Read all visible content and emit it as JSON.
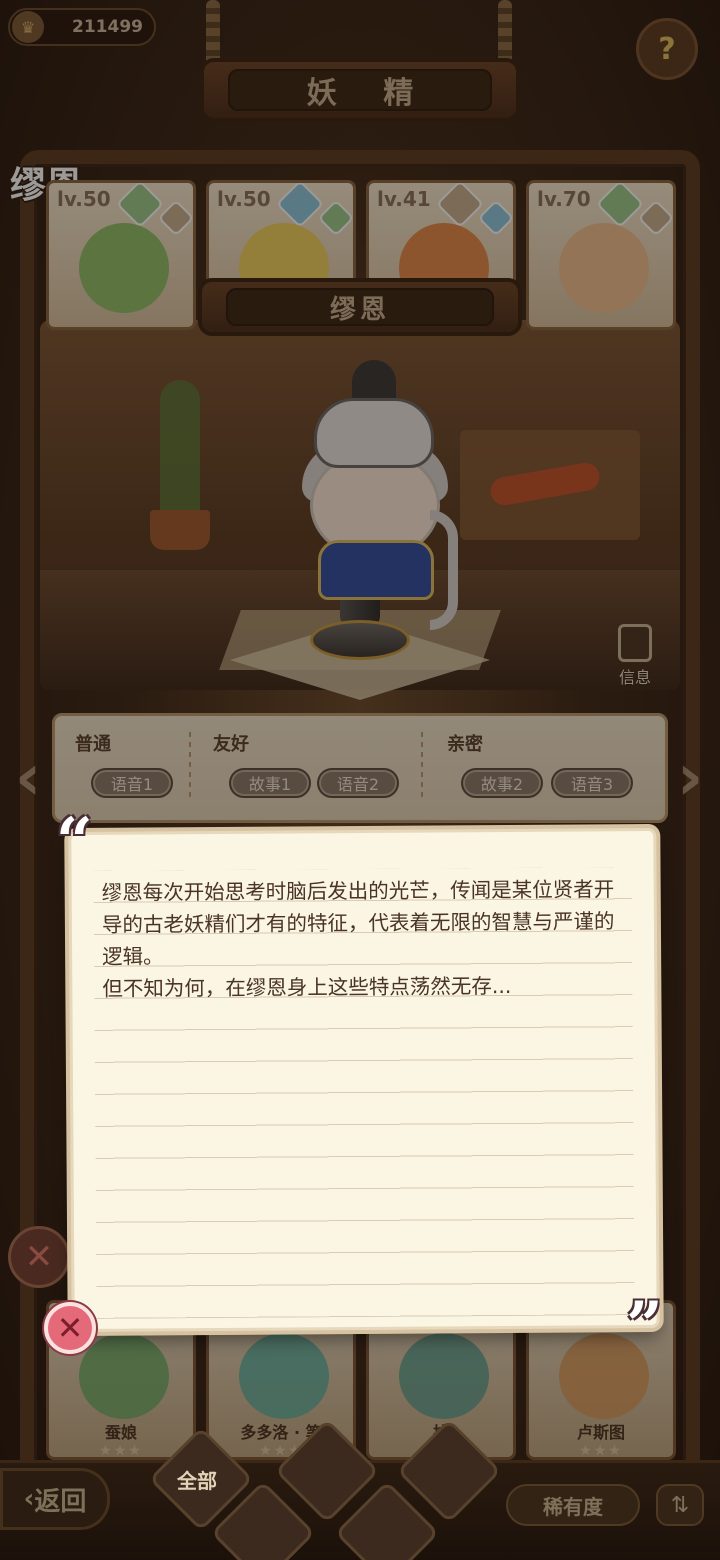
{
  "header": {
    "coins": "211499",
    "title": "妖 精",
    "character_name": "缪恩"
  },
  "fairy_cards_top": [
    {
      "level": "lv.50",
      "face_color": "#8fbf6a"
    },
    {
      "level": "lv.50",
      "face_color": "#f0d060"
    },
    {
      "level": "lv.41",
      "face_color": "#e58a4a"
    },
    {
      "level": "lv.70",
      "face_color": "#f0c090"
    }
  ],
  "selected_name_plank": "缪恩",
  "info_label": "信息",
  "story": {
    "groups": [
      {
        "title": "普通",
        "buttons": [
          "语音1"
        ]
      },
      {
        "title": "友好",
        "buttons": [
          "故事1",
          "语音2"
        ]
      },
      {
        "title": "亲密",
        "buttons": [
          "故事2",
          "语音3"
        ]
      }
    ]
  },
  "note": {
    "text": "缪恩每次开始思考时脑后发出的光芒，传闻是某位贤者开导的古老妖精们才有的特征，代表着无限的智慧与严谨的逻辑。\n但不知为何，在缪恩身上这些特点荡然无存..."
  },
  "fairy_cards_bottom": [
    {
      "name": "蚕娘",
      "face_color": "#6fae6a"
    },
    {
      "name": "多多洛 · 笔",
      "face_color": "#5fb0a0"
    },
    {
      "name": "拉",
      "face_color": "#5fa090"
    },
    {
      "name": "卢斯图",
      "face_color": "#d89a5a"
    }
  ],
  "bottom_bar": {
    "back_label": "返回",
    "filter_all_label": "全部",
    "rarity_label": "稀有度"
  },
  "colors": {
    "accent_red": "#e46a7a",
    "paper": "#fbf5e3",
    "wood": "#5b3a22"
  }
}
